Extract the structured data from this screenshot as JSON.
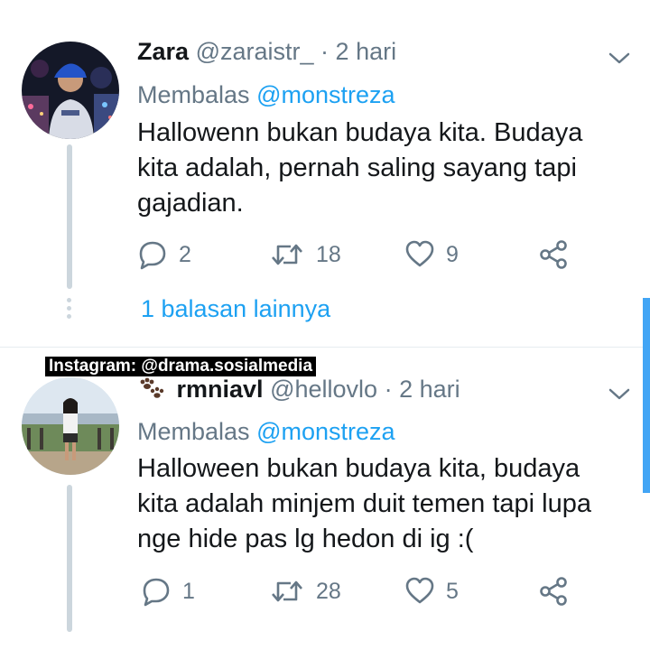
{
  "watermark": "Instagram: @drama.sosialmedia",
  "tweets": [
    {
      "name": "Zara",
      "handle": "@zaraistr_",
      "dot": "·",
      "time": "2 hari",
      "reply_prefix": "Membalas",
      "reply_to": "@monstreza",
      "text": "Hallowenn bukan budaya kita. Budaya\nkita adalah, pernah saling sayang tapi\ngajadian.",
      "replies": "2",
      "retweets": "18",
      "likes": "9",
      "more_replies": "1 balasan lainnya"
    },
    {
      "name_emoji": "paw-prints-icon",
      "name": "rmniavl",
      "handle": "@hellovlo",
      "dot": "·",
      "time": "2 hari",
      "reply_prefix": "Membalas",
      "reply_to": "@monstreza",
      "text": "Halloween bukan budaya kita, budaya\nkita adalah minjem duit temen tapi lupa\nnge hide pas lg hedon di ig :(",
      "replies": "1",
      "retweets": "28",
      "likes": "5"
    }
  ],
  "colors": {
    "text": "#14171a",
    "secondary": "#657786",
    "link": "#1da1f2",
    "thread_line": "#ccd6dd"
  }
}
